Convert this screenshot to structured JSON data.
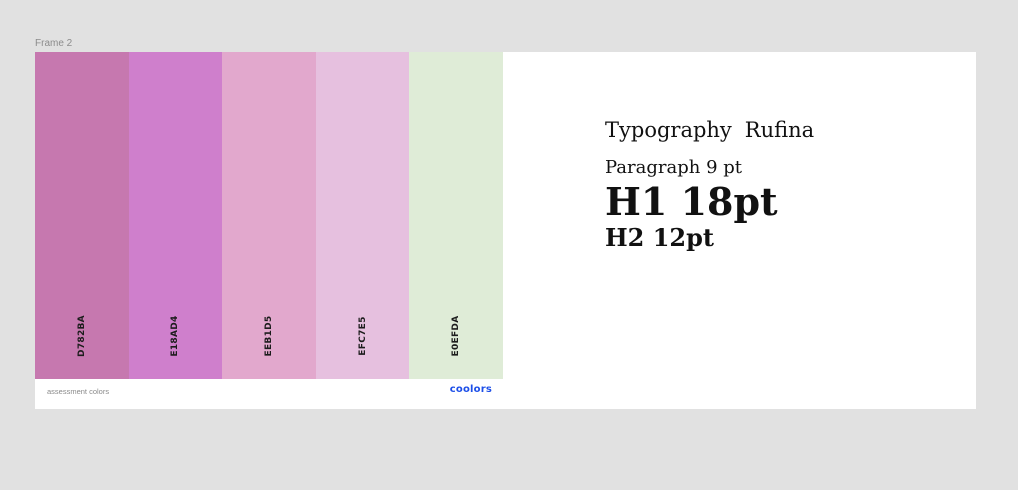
{
  "frame": {
    "label": "Frame 2"
  },
  "palette": {
    "swatches": [
      {
        "hex": "D782BA",
        "color": "#c678af"
      },
      {
        "hex": "E18AD4",
        "color": "#cf7fcc"
      },
      {
        "hex": "EEB1D5",
        "color": "#e2a8cd"
      },
      {
        "hex": "EFC7E5",
        "color": "#e6c0df"
      },
      {
        "hex": "E0EFDA",
        "color": "#dfecd7"
      }
    ],
    "name": "assessment colors",
    "brand": "coolors"
  },
  "typography": {
    "heading": "Typography",
    "font_name": "Rufina",
    "paragraph": "Paragraph 9 pt",
    "h1": "H1 18pt",
    "h2": "H2 12pt"
  }
}
